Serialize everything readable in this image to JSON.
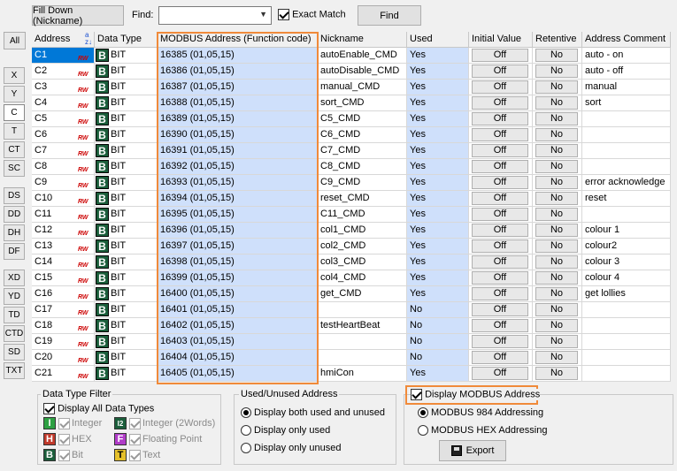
{
  "toolbar": {
    "fill_down_label": "Fill Down (Nickname)",
    "find_label": "Find:",
    "find_value": "",
    "exact_match_label": "Exact Match",
    "exact_match_checked": true,
    "find_button": "Find"
  },
  "filters": {
    "all": "All",
    "items": [
      "X",
      "Y",
      "C",
      "T",
      "CT",
      "SC",
      "DS",
      "DD",
      "DH",
      "DF",
      "XD",
      "YD",
      "TD",
      "CTD",
      "SD",
      "TXT"
    ],
    "selected": "C"
  },
  "grid": {
    "headers": {
      "address": "Address",
      "data_type": "Data Type",
      "modbus": "MODBUS Address (Function code)",
      "nickname": "Nickname",
      "used": "Used",
      "initial_value": "Initial Value",
      "retentive": "Retentive",
      "comment": "Address Comment"
    },
    "rw_label": "RW",
    "type_icon": "B",
    "rows": [
      {
        "address": "C1",
        "type": "BIT",
        "modbus": "16385 (01,05,15)",
        "nickname": "autoEnable_CMD",
        "used": "Yes",
        "initial": "Off",
        "retentive": "No",
        "comment": "auto - on"
      },
      {
        "address": "C2",
        "type": "BIT",
        "modbus": "16386 (01,05,15)",
        "nickname": "autoDisable_CMD",
        "used": "Yes",
        "initial": "Off",
        "retentive": "No",
        "comment": "auto - off"
      },
      {
        "address": "C3",
        "type": "BIT",
        "modbus": "16387 (01,05,15)",
        "nickname": "manual_CMD",
        "used": "Yes",
        "initial": "Off",
        "retentive": "No",
        "comment": "manual"
      },
      {
        "address": "C4",
        "type": "BIT",
        "modbus": "16388 (01,05,15)",
        "nickname": "sort_CMD",
        "used": "Yes",
        "initial": "Off",
        "retentive": "No",
        "comment": "sort"
      },
      {
        "address": "C5",
        "type": "BIT",
        "modbus": "16389 (01,05,15)",
        "nickname": "C5_CMD",
        "used": "Yes",
        "initial": "Off",
        "retentive": "No",
        "comment": ""
      },
      {
        "address": "C6",
        "type": "BIT",
        "modbus": "16390 (01,05,15)",
        "nickname": "C6_CMD",
        "used": "Yes",
        "initial": "Off",
        "retentive": "No",
        "comment": ""
      },
      {
        "address": "C7",
        "type": "BIT",
        "modbus": "16391 (01,05,15)",
        "nickname": "C7_CMD",
        "used": "Yes",
        "initial": "Off",
        "retentive": "No",
        "comment": ""
      },
      {
        "address": "C8",
        "type": "BIT",
        "modbus": "16392 (01,05,15)",
        "nickname": "C8_CMD",
        "used": "Yes",
        "initial": "Off",
        "retentive": "No",
        "comment": ""
      },
      {
        "address": "C9",
        "type": "BIT",
        "modbus": "16393 (01,05,15)",
        "nickname": "C9_CMD",
        "used": "Yes",
        "initial": "Off",
        "retentive": "No",
        "comment": "error acknowledge"
      },
      {
        "address": "C10",
        "type": "BIT",
        "modbus": "16394 (01,05,15)",
        "nickname": "reset_CMD",
        "used": "Yes",
        "initial": "Off",
        "retentive": "No",
        "comment": "reset"
      },
      {
        "address": "C11",
        "type": "BIT",
        "modbus": "16395 (01,05,15)",
        "nickname": "C11_CMD",
        "used": "Yes",
        "initial": "Off",
        "retentive": "No",
        "comment": ""
      },
      {
        "address": "C12",
        "type": "BIT",
        "modbus": "16396 (01,05,15)",
        "nickname": "col1_CMD",
        "used": "Yes",
        "initial": "Off",
        "retentive": "No",
        "comment": "colour 1"
      },
      {
        "address": "C13",
        "type": "BIT",
        "modbus": "16397 (01,05,15)",
        "nickname": "col2_CMD",
        "used": "Yes",
        "initial": "Off",
        "retentive": "No",
        "comment": "colour2"
      },
      {
        "address": "C14",
        "type": "BIT",
        "modbus": "16398 (01,05,15)",
        "nickname": "col3_CMD",
        "used": "Yes",
        "initial": "Off",
        "retentive": "No",
        "comment": "colour 3"
      },
      {
        "address": "C15",
        "type": "BIT",
        "modbus": "16399 (01,05,15)",
        "nickname": "col4_CMD",
        "used": "Yes",
        "initial": "Off",
        "retentive": "No",
        "comment": "colour 4"
      },
      {
        "address": "C16",
        "type": "BIT",
        "modbus": "16400 (01,05,15)",
        "nickname": "get_CMD",
        "used": "Yes",
        "initial": "Off",
        "retentive": "No",
        "comment": "get lollies"
      },
      {
        "address": "C17",
        "type": "BIT",
        "modbus": "16401 (01,05,15)",
        "nickname": "",
        "used": "No",
        "initial": "Off",
        "retentive": "No",
        "comment": ""
      },
      {
        "address": "C18",
        "type": "BIT",
        "modbus": "16402 (01,05,15)",
        "nickname": "testHeartBeat",
        "used": "No",
        "initial": "Off",
        "retentive": "No",
        "comment": ""
      },
      {
        "address": "C19",
        "type": "BIT",
        "modbus": "16403 (01,05,15)",
        "nickname": "",
        "used": "No",
        "initial": "Off",
        "retentive": "No",
        "comment": ""
      },
      {
        "address": "C20",
        "type": "BIT",
        "modbus": "16404 (01,05,15)",
        "nickname": "",
        "used": "No",
        "initial": "Off",
        "retentive": "No",
        "comment": ""
      },
      {
        "address": "C21",
        "type": "BIT",
        "modbus": "16405 (01,05,15)",
        "nickname": "hmiCon",
        "used": "Yes",
        "initial": "Off",
        "retentive": "No",
        "comment": ""
      }
    ]
  },
  "data_type_filter": {
    "title": "Data Type Filter",
    "display_all": "Display All Data Types",
    "display_all_checked": true,
    "types": [
      {
        "icon": "I",
        "label": "Integer",
        "color": "#2ea043"
      },
      {
        "icon": "I2",
        "label": "Integer (2Words)",
        "color": "#1b5e3b"
      },
      {
        "icon": "H",
        "label": "HEX",
        "color": "#c0392b"
      },
      {
        "icon": "F",
        "label": "Floating Point",
        "color": "#b03cc8"
      },
      {
        "icon": "B",
        "label": "Bit",
        "color": "#1b5e3b"
      },
      {
        "icon": "T",
        "label": "Text",
        "color": "#e5c02a"
      }
    ]
  },
  "used_unused": {
    "title": "Used/Unused Address",
    "options": [
      "Display both used and unused",
      "Display only used",
      "Display only unused"
    ],
    "selected": 0
  },
  "modbus_panel": {
    "display_label": "Display MODBUS Address",
    "display_checked": true,
    "options": [
      "MODBUS 984 Addressing",
      "MODBUS HEX Addressing"
    ],
    "selected": 0,
    "export_label": "Export"
  },
  "colors": {
    "highlight_orange": "#f08a3a",
    "selection_blue": "#0078d7",
    "modbus_column_blue": "#cfe0fb"
  }
}
